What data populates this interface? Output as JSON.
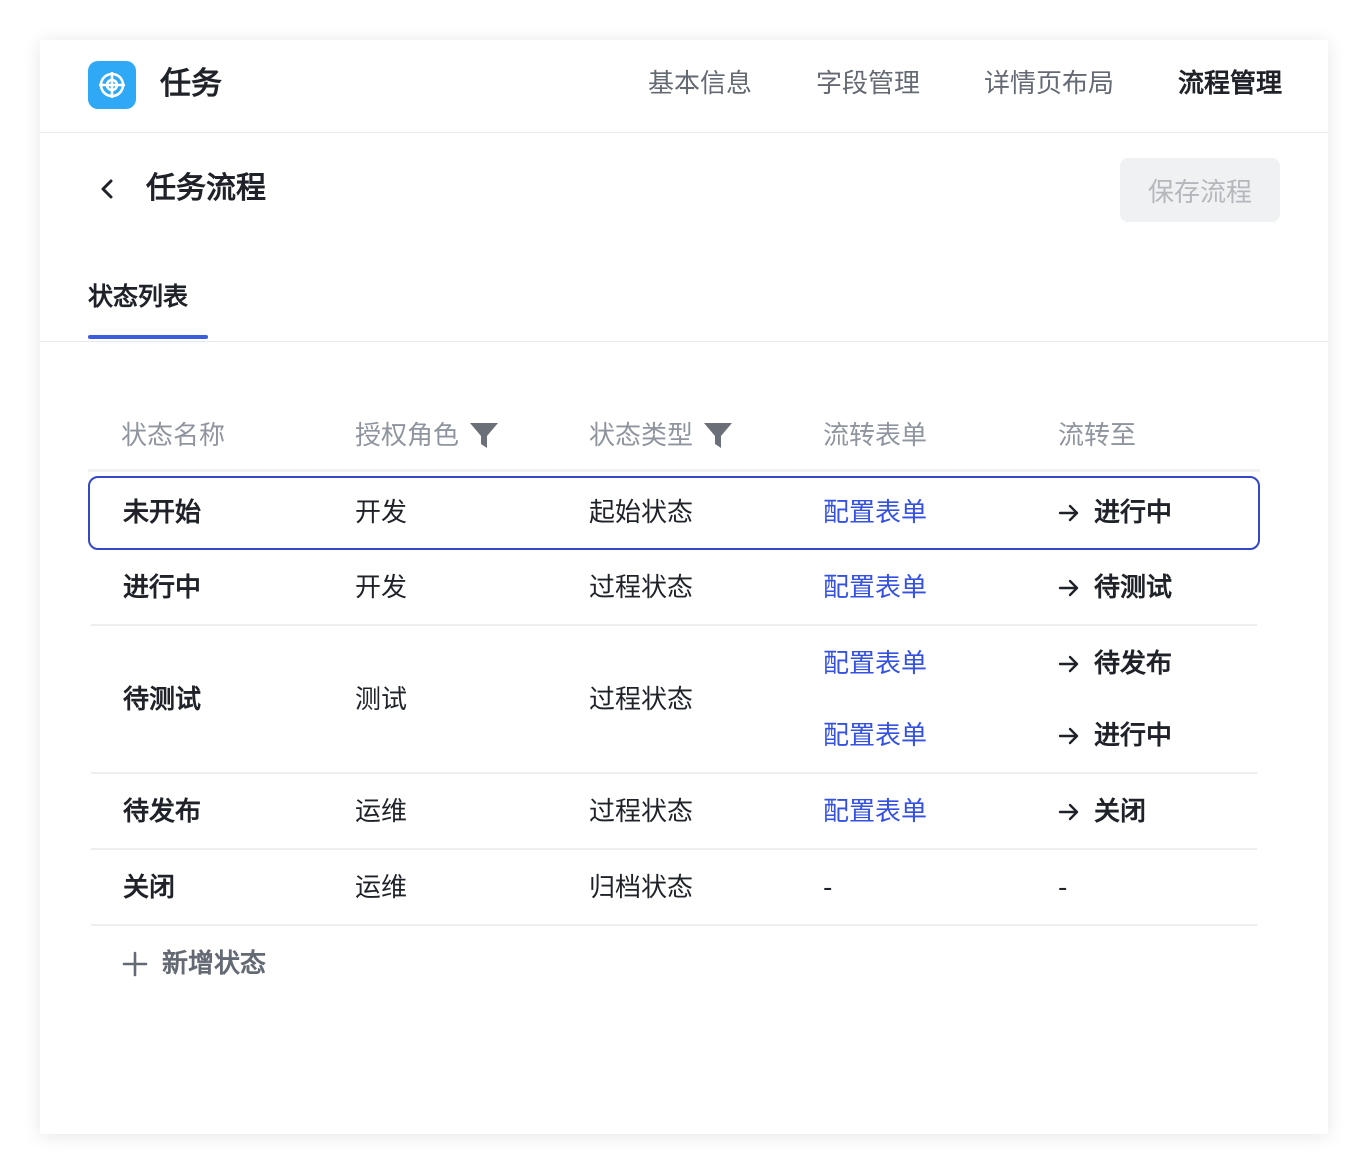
{
  "app": {
    "title": "任务",
    "icon": "target-icon",
    "accent": "#2fa8f5"
  },
  "nav": {
    "items": [
      {
        "label": "基本信息",
        "active": false
      },
      {
        "label": "字段管理",
        "active": false
      },
      {
        "label": "详情页布局",
        "active": false
      },
      {
        "label": "流程管理",
        "active": true
      }
    ]
  },
  "page": {
    "title": "任务流程",
    "save_label": "保存流程"
  },
  "tabs": {
    "items": [
      {
        "label": "状态列表",
        "active": true
      }
    ]
  },
  "table": {
    "headers": {
      "name": "状态名称",
      "role": "授权角色",
      "type": "状态类型",
      "form": "流转表单",
      "target": "流转至"
    },
    "rows": [
      {
        "name": "未开始",
        "role": "开发",
        "type": "起始状态",
        "transitions": [
          {
            "form": "配置表单",
            "target": "进行中"
          }
        ],
        "selected": true
      },
      {
        "name": "进行中",
        "role": "开发",
        "type": "过程状态",
        "transitions": [
          {
            "form": "配置表单",
            "target": "待测试"
          }
        ]
      },
      {
        "name": "待测试",
        "role": "测试",
        "type": "过程状态",
        "transitions": [
          {
            "form": "配置表单",
            "target": "待发布"
          },
          {
            "form": "配置表单",
            "target": "进行中"
          }
        ]
      },
      {
        "name": "待发布",
        "role": "运维",
        "type": "过程状态",
        "transitions": [
          {
            "form": "配置表单",
            "target": "关闭"
          }
        ]
      },
      {
        "name": "关闭",
        "role": "运维",
        "type": "归档状态",
        "form_placeholder": "-",
        "target_placeholder": "-"
      }
    ],
    "add_label": "新增状态"
  },
  "colors": {
    "link": "#3451e3",
    "selected_border": "#3448c5",
    "tab_underline": "#3c5ce0"
  }
}
